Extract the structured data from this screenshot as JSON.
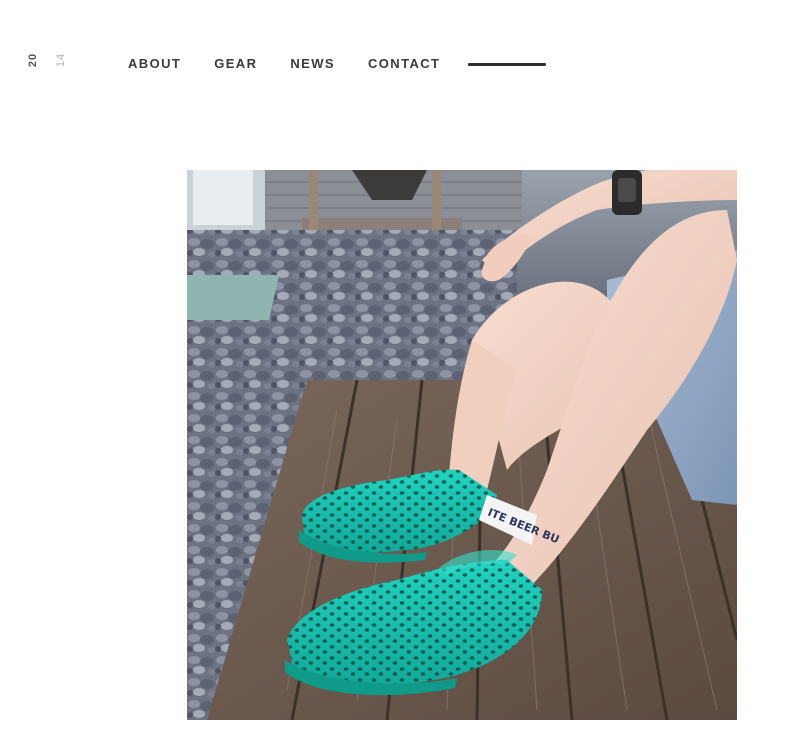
{
  "brand": {
    "year_part_1": "20",
    "year_part_2": "14"
  },
  "nav": {
    "items": [
      {
        "label": "ABOUT"
      },
      {
        "label": "GEAR"
      },
      {
        "label": "NEWS"
      },
      {
        "label": "CONTACT"
      }
    ]
  },
  "photo": {
    "subject": "turquoise perforated slip-on shoes on wooden boardwalk",
    "sock_text": "ITE BEER BU"
  },
  "colors": {
    "nav_text": "#3b3b3b",
    "rule": "#2f2f2f",
    "shoe": "#19c3b0",
    "deck": "#6e5a4d",
    "pebbles": "#7b8090"
  }
}
